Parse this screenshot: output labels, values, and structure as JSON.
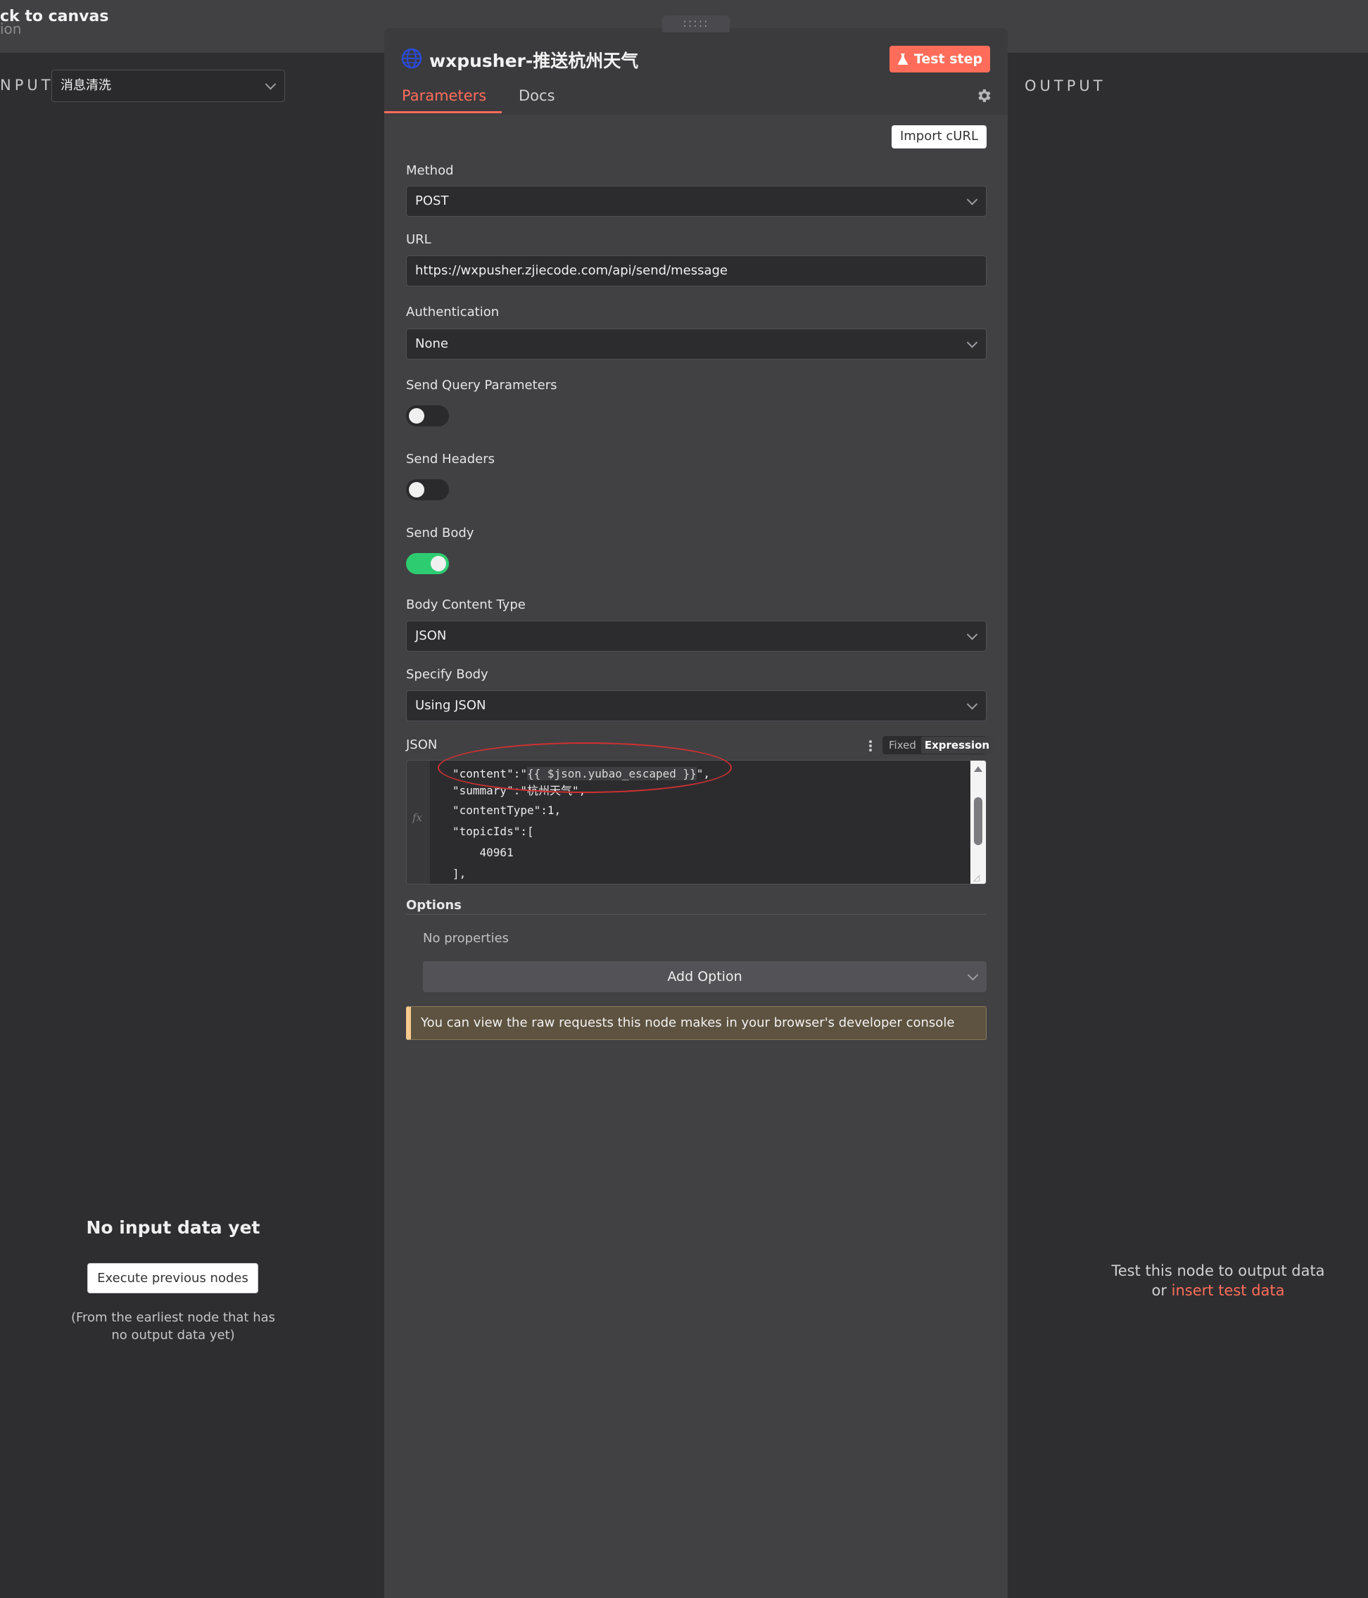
{
  "topbar": {
    "back_label": "ck to canvas",
    "sub_label": "ion",
    "drag_handle": ":::::"
  },
  "input": {
    "label": "NPUT",
    "selected_node": "消息清洗",
    "empty_title": "No input data yet",
    "execute_button": "Execute previous nodes",
    "execute_note": "(From the earliest node that has no output data yet)"
  },
  "output": {
    "label": "OUTPUT",
    "note_line1": "Test this node to output data",
    "note_or": "or ",
    "note_link": "insert test data"
  },
  "panel": {
    "title": "wxpusher-推送杭州天气",
    "test_button": "Test step",
    "tabs": [
      {
        "label": "Parameters",
        "active": true
      },
      {
        "label": "Docs",
        "active": false
      }
    ],
    "import_button": "Import cURL",
    "fields": {
      "method": {
        "label": "Method",
        "value": "POST"
      },
      "url": {
        "label": "URL",
        "value": "https://wxpusher.zjiecode.com/api/send/message"
      },
      "authentication": {
        "label": "Authentication",
        "value": "None"
      },
      "send_query": {
        "label": "Send Query Parameters",
        "on": false
      },
      "send_headers": {
        "label": "Send Headers",
        "on": false
      },
      "send_body": {
        "label": "Send Body",
        "on": true
      },
      "body_content_type": {
        "label": "Body Content Type",
        "value": "JSON"
      },
      "specify_body": {
        "label": "Specify Body",
        "value": "Using JSON"
      }
    },
    "json": {
      "label": "JSON",
      "mode_fixed": "Fixed",
      "mode_expression": "Expression",
      "fx": "fx",
      "lines": {
        "l1_pre": "\"content\":\"",
        "l1_expr": "{{ $json.yubao_escaped }}",
        "l1_post": "\",",
        "l2": "\"summary\":\"杭州天气\",",
        "l3": "\"contentType\":1,",
        "l4": "\"topicIds\":[",
        "l5": "    40961",
        "l6": "],"
      }
    },
    "options": {
      "label": "Options",
      "empty": "No properties",
      "add_button": "Add Option"
    },
    "notice": "You can view the raw requests this node makes in your browser's developer console"
  },
  "colors": {
    "accent": "#ff6d5a",
    "toggle_on": "#2ecc71",
    "annotation": "#d23030"
  }
}
